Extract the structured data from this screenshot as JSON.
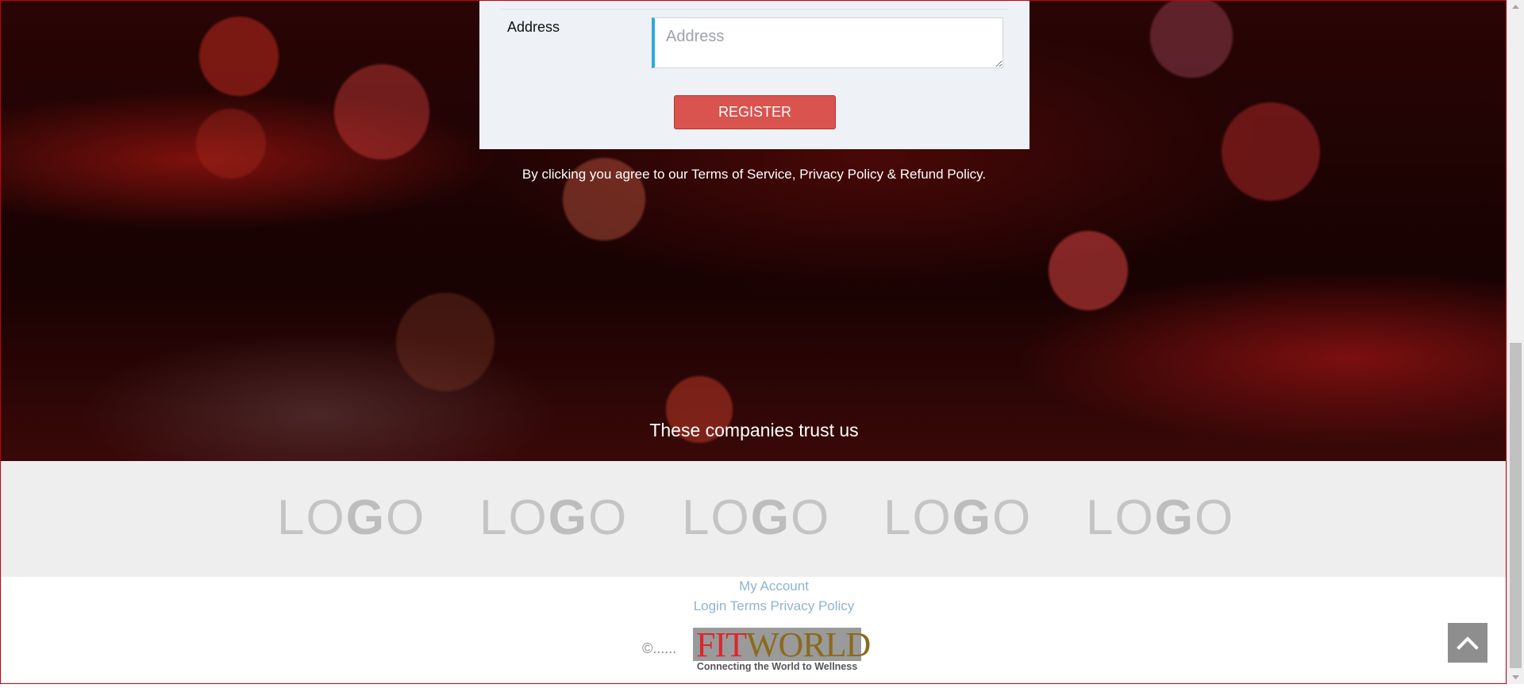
{
  "form": {
    "address_label": "Address",
    "address_placeholder": "Address",
    "address_value": "",
    "register_label": "REGISTER"
  },
  "terms_text": "By clicking you agree to our Terms of Service, Privacy Policy & Refund Policy.",
  "trust_heading": "These companies trust us",
  "logos": [
    {
      "lo": "LO",
      "g": "G",
      "o": "O"
    },
    {
      "lo": "LO",
      "g": "G",
      "o": "O"
    },
    {
      "lo": "LO",
      "g": "G",
      "o": "O"
    },
    {
      "lo": "LO",
      "g": "G",
      "o": "O"
    },
    {
      "lo": "LO",
      "g": "G",
      "o": "O"
    }
  ],
  "footer": {
    "my_account": "My Account",
    "login": "Login",
    "terms": "Terms",
    "privacy_policy": "Privacy Policy",
    "copyright": "©......",
    "brand": {
      "name_part_1": "FIT",
      "name_part_2": "WORLD",
      "tagline": "Connecting the World to Wellness"
    }
  },
  "colors": {
    "accent_button": "#d9534f",
    "input_focus_bar": "#2eaadc",
    "footer_link": "#8fb4cd",
    "hero_background": "#1a0303"
  },
  "icons": {
    "back_to_top": "chevron-up-icon",
    "scroll_up": "triangle-up-icon",
    "scroll_down": "triangle-down-icon"
  }
}
